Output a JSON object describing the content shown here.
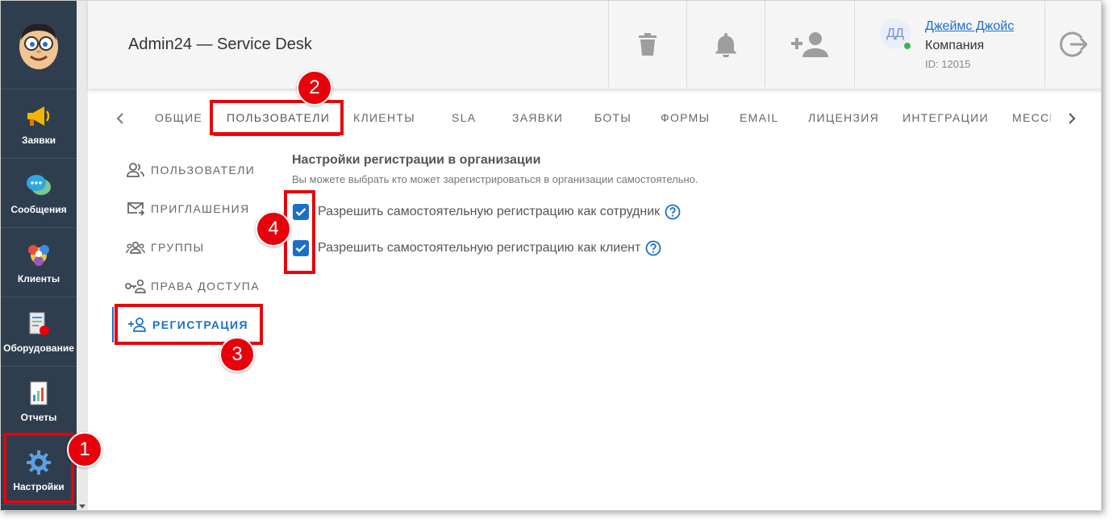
{
  "app_title": "Admin24 — Service Desk",
  "sidebar": {
    "items": [
      {
        "label": "Заявки",
        "icon": "megaphone-icon"
      },
      {
        "label": "Сообщения",
        "icon": "chat-bubbles-icon"
      },
      {
        "label": "Клиенты",
        "icon": "clients-icon"
      },
      {
        "label": "Оборудование",
        "icon": "equipment-icon"
      },
      {
        "label": "Отчеты",
        "icon": "reports-icon"
      },
      {
        "label": "Настройки",
        "icon": "gear-icon"
      }
    ]
  },
  "header": {
    "buttons": [
      "trash-icon",
      "bell-icon",
      "add-user-icon",
      "logout-icon"
    ],
    "user": {
      "initials": "ДД",
      "name": "Джеймс Джойс",
      "company": "Компания",
      "id": "ID: 12015"
    }
  },
  "tabs": [
    "ОБЩИЕ",
    "ПОЛЬЗОВАТЕЛИ",
    "КЛИЕНТЫ",
    "SLA",
    "ЗАЯВКИ",
    "БОТЫ",
    "ФОРМЫ",
    "EMAIL",
    "ЛИЦЕНЗИЯ",
    "ИНТЕГРАЦИИ",
    "МЕССЕ"
  ],
  "active_tab": "ПОЛЬЗОВАТЕЛИ",
  "submenu": [
    {
      "label": "ПОЛЬЗОВАТЕЛИ",
      "icon": "users-icon"
    },
    {
      "label": "ПРИГЛАШЕНИЯ",
      "icon": "mail-send-icon"
    },
    {
      "label": "ГРУППЫ",
      "icon": "groups-icon"
    },
    {
      "label": "ПРАВА ДОСТУПА",
      "icon": "key-user-icon"
    },
    {
      "label": "РЕГИСТРАЦИЯ",
      "icon": "add-person-icon"
    }
  ],
  "active_submenu": "РЕГИСТРАЦИЯ",
  "content": {
    "title": "Настройки регистрации в организации",
    "description": "Вы можете выбрать кто может зарегистрироваться в организации самостоятельно.",
    "options": [
      {
        "label": "Разрешить самостоятельную регистрацию как сотрудник",
        "checked": true
      },
      {
        "label": "Разрешить самостоятельную регистрацию как клиент",
        "checked": true
      }
    ]
  },
  "annotations": [
    "1",
    "2",
    "3",
    "4"
  ],
  "colors": {
    "accent": "#1a6fc9",
    "annotation": "#e8000b",
    "sidebar": "#2f3e4e"
  }
}
